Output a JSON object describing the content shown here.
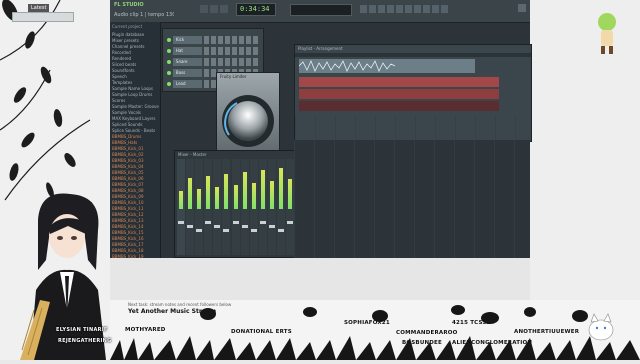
{
  "stream": {
    "latest_label": "Latest",
    "title_line": "Yet Another Music Stream",
    "small_line": "Next task: stream notes and recent followers below",
    "streamer_name": "ELYSIAN TINARIF",
    "streamer_sub": "REJENGATHERING",
    "credits": [
      "MOTHYARED",
      "DONATIONAL ERTS",
      "SOPHIAFOX21",
      "COMMANDERAROO",
      "4215 TCSSL",
      "ANOTHERTIUUEWER",
      "BOSBUNDEE",
      "ALIENCONGLOMERATION"
    ]
  },
  "daw": {
    "title": "FL STUDIO",
    "pattern_display": "Audio clip 1 | tempo 130",
    "time_display": "0:34:34",
    "browser_header": "Current project",
    "browser_items": [
      "Plugin database",
      "Mixer presets",
      "Channel presets",
      "Recorded",
      "Rendered",
      "Sliced beats",
      "Soundfonts",
      "Speech",
      "Templates",
      "Sample Name Loops",
      "Sample Loop Drums",
      "Scores",
      "Sample Master: Grooves",
      "Sample Vocals",
      "MAX Keyboard Layers",
      "Spliced Sounds",
      "Splice Sounds - Beats",
      "BBMBS_Drums",
      "BBMBS_Hats",
      "BBMBS_Kick_01",
      "BBMBS_Kick_02",
      "BBMBS_Kick_03",
      "BBMBS_Kick_04",
      "BBMBS_Kick_05",
      "BBMBS_Kick_06",
      "BBMBS_Kick_07",
      "BBMBS_Kick_08",
      "BBMBS_Kick_09",
      "BBMBS_Kick_10",
      "BBMBS_Kick_11",
      "BBMBS_Kick_12",
      "BBMBS_Kick_13",
      "BBMBS_Kick_14",
      "BBMBS_Kick_15",
      "BBMBS_Kick_16",
      "BBMBS_Kick_17",
      "BBMBS_Kick_18",
      "BBMBS_Kick_19",
      "BBMBS_Kick_20",
      "BBMBS_Kick_21"
    ],
    "channels": [
      "Kick",
      "Hat",
      "Snare",
      "Bass",
      "Lead"
    ],
    "playlist_title": "Playlist - Arrangement",
    "tracks": [
      "Track 1",
      "Track 2",
      "Track 3",
      "Track 4"
    ],
    "plugin_title": "Fruity Limiter",
    "mixer_title": "Mixer - Master",
    "mixer_fx_slots": [
      "Fruity parametric EQ 2",
      "Fruity Limiter",
      "Slot 3",
      "Slot 4",
      "Slot 5",
      "Slot 6",
      "Slot 7",
      "Slot 8"
    ],
    "mixer_track_count": 24
  },
  "colors": {
    "daw_bg": "#2c3439",
    "accent_green": "#7fe26a",
    "clip_red": "#b24a4a",
    "clip_teal": "#3d7c7a"
  }
}
